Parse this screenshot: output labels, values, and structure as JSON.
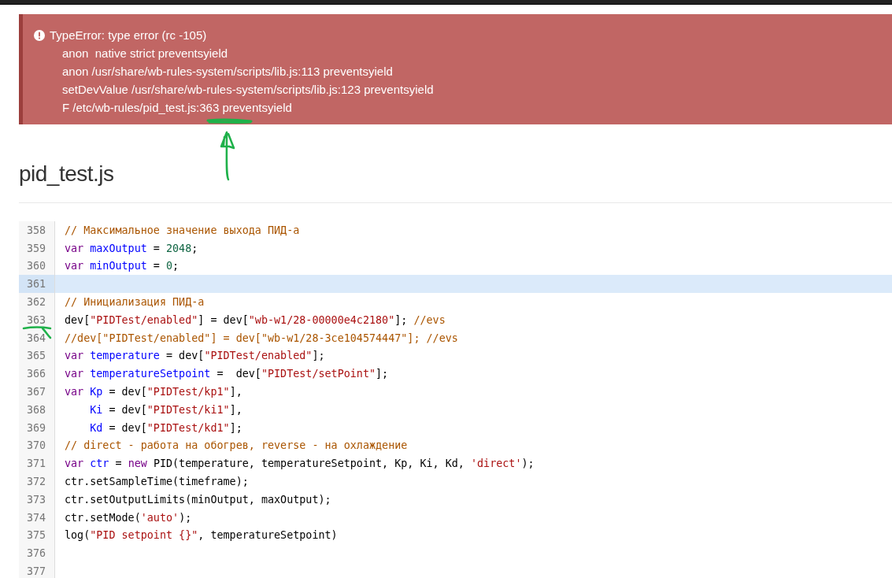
{
  "error": {
    "title": "TypeError: type error (rc -105)",
    "trace": [
      "anon  native strict preventsyield",
      "anon /usr/share/wb-rules-system/scripts/lib.js:113 preventsyield",
      "setDevValue /usr/share/wb-rules-system/scripts/lib.js:123 preventsyield",
      "F /etc/wb-rules/pid_test.js:363 preventsyield"
    ]
  },
  "heading": "pid_test.js",
  "code": [
    {
      "number": "358",
      "selected": false,
      "tokens": [
        {
          "kind": "comment",
          "text": "// Максимальное значение выхода ПИД-а"
        }
      ]
    },
    {
      "number": "359",
      "selected": false,
      "tokens": [
        {
          "kind": "keyword",
          "text": "var "
        },
        {
          "kind": "def",
          "text": "maxOutput"
        },
        {
          "kind": "plain",
          "text": " = "
        },
        {
          "kind": "number",
          "text": "2048"
        },
        {
          "kind": "plain",
          "text": ";"
        }
      ]
    },
    {
      "number": "360",
      "selected": false,
      "tokens": [
        {
          "kind": "keyword",
          "text": "var "
        },
        {
          "kind": "def",
          "text": "minOutput"
        },
        {
          "kind": "plain",
          "text": " = "
        },
        {
          "kind": "number",
          "text": "0"
        },
        {
          "kind": "plain",
          "text": ";"
        }
      ]
    },
    {
      "number": "361",
      "selected": true
    },
    {
      "number": "362",
      "selected": false,
      "tokens": [
        {
          "kind": "comment",
          "text": "// Инициализация ПИД-а"
        }
      ]
    },
    {
      "number": "363",
      "selected": false,
      "tokens": [
        {
          "kind": "plain",
          "text": "dev["
        },
        {
          "kind": "string",
          "text": "\"PIDTest/enabled\""
        },
        {
          "kind": "plain",
          "text": "] = dev["
        },
        {
          "kind": "string",
          "text": "\"wb-w1/28-00000e4c2180\""
        },
        {
          "kind": "plain",
          "text": "]; "
        },
        {
          "kind": "comment",
          "text": "//evs"
        }
      ]
    },
    {
      "number": "364",
      "selected": false,
      "tokens": [
        {
          "kind": "comment",
          "text": "//dev[\"PIDTest/enabled\"] = dev[\"wb-w1/28-3ce104574447\"]; //evs"
        }
      ]
    },
    {
      "number": "365",
      "selected": false,
      "tokens": [
        {
          "kind": "keyword",
          "text": "var "
        },
        {
          "kind": "def",
          "text": "temperature"
        },
        {
          "kind": "plain",
          "text": " = dev["
        },
        {
          "kind": "string",
          "text": "\"PIDTest/enabled\""
        },
        {
          "kind": "plain",
          "text": "];"
        }
      ]
    },
    {
      "number": "366",
      "selected": false,
      "tokens": [
        {
          "kind": "keyword",
          "text": "var "
        },
        {
          "kind": "def",
          "text": "temperatureSetpoint"
        },
        {
          "kind": "plain",
          "text": " =  dev["
        },
        {
          "kind": "string",
          "text": "\"PIDTest/setPoint\""
        },
        {
          "kind": "plain",
          "text": "];"
        }
      ]
    },
    {
      "number": "367",
      "selected": false,
      "tokens": [
        {
          "kind": "keyword",
          "text": "var "
        },
        {
          "kind": "def",
          "text": "Kp"
        },
        {
          "kind": "plain",
          "text": " = dev["
        },
        {
          "kind": "string",
          "text": "\"PIDTest/kp1\""
        },
        {
          "kind": "plain",
          "text": "],"
        }
      ]
    },
    {
      "number": "368",
      "selected": false,
      "tokens": [
        {
          "kind": "def",
          "text": "    Ki"
        },
        {
          "kind": "plain",
          "text": " = dev["
        },
        {
          "kind": "string",
          "text": "\"PIDTest/ki1\""
        },
        {
          "kind": "plain",
          "text": "],"
        }
      ]
    },
    {
      "number": "369",
      "selected": false,
      "tokens": [
        {
          "kind": "def",
          "text": "    Kd"
        },
        {
          "kind": "plain",
          "text": " = dev["
        },
        {
          "kind": "string",
          "text": "\"PIDTest/kd1\""
        },
        {
          "kind": "plain",
          "text": "];"
        }
      ]
    },
    {
      "number": "370",
      "selected": false,
      "tokens": [
        {
          "kind": "comment",
          "text": "// direct - работа на обогрев, reverse - на охлаждение"
        }
      ]
    },
    {
      "number": "371",
      "selected": false,
      "tokens": [
        {
          "kind": "keyword",
          "text": "var "
        },
        {
          "kind": "def",
          "text": "ctr"
        },
        {
          "kind": "plain",
          "text": " = "
        },
        {
          "kind": "keyword",
          "text": "new "
        },
        {
          "kind": "plain",
          "text": "PID(temperature, temperatureSetpoint, Kp, Ki, Kd, "
        },
        {
          "kind": "string",
          "text": "'direct'"
        },
        {
          "kind": "plain",
          "text": ");"
        }
      ]
    },
    {
      "number": "372",
      "selected": false,
      "tokens": [
        {
          "kind": "plain",
          "text": "ctr.setSampleTime(timeframe);"
        }
      ]
    },
    {
      "number": "373",
      "selected": false,
      "tokens": [
        {
          "kind": "plain",
          "text": "ctr.setOutputLimits(minOutput, maxOutput);"
        }
      ]
    },
    {
      "number": "374",
      "selected": false,
      "tokens": [
        {
          "kind": "plain",
          "text": "ctr.setMode("
        },
        {
          "kind": "string",
          "text": "'auto'"
        },
        {
          "kind": "plain",
          "text": ");"
        }
      ]
    },
    {
      "number": "375",
      "selected": false,
      "tokens": [
        {
          "kind": "plain",
          "text": "log("
        },
        {
          "kind": "string",
          "text": "\"PID setpoint {}\""
        },
        {
          "kind": "plain",
          "text": ", temperatureSetpoint)"
        }
      ]
    },
    {
      "number": "376",
      "selected": false
    },
    {
      "number": "377",
      "selected": false
    }
  ]
}
